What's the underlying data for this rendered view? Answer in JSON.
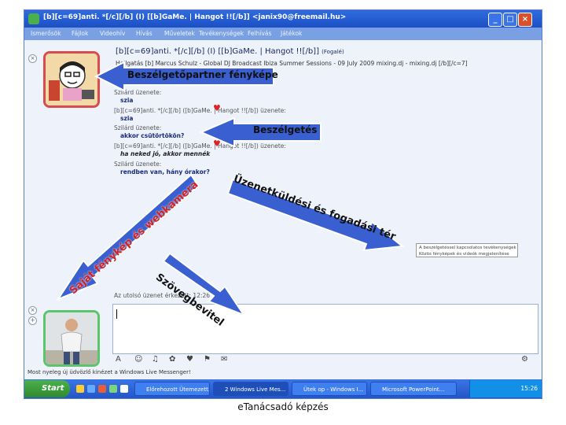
{
  "window": {
    "title": "[b][c=69]anti. *[/c][/b] (I) [[b]GaMe. | Hangot !![/b]] <janix90@freemail.hu>",
    "controls": {
      "minimize": "_",
      "maximize": "□",
      "close": "×"
    }
  },
  "menu": {
    "items": [
      "Ismerősök",
      "Fájlok",
      "Videohív",
      "Hívás",
      "Műveletek",
      "Tevékenységek",
      "Felhívás",
      "Játékok"
    ]
  },
  "conversation": {
    "contact_line": "[b][c=69]anti. *[/c][/b] (I) [[b]GaMe. | Hangot !![/b]]",
    "contact_email": "(Fogalé)",
    "status_line": "Hallgatás [b] Marcus Schulz - Global DJ Broadcast Ibiza Summer Sessions - 09 July 2009 mixing.dj - mixing.dj [/b][/c=7]"
  },
  "messages": [
    {
      "who": "Szilárd üzenete:",
      "text": "szia",
      "style": "normal"
    },
    {
      "who": "[b][c=69]anti. *[/c][/b]   ([b]GaMe. | Hangot !![/b]) üzenete:",
      "text": "szia",
      "style": "normal"
    },
    {
      "who": "Szilárd üzenete:",
      "text": "akkor csütörtökön?",
      "style": "normal"
    },
    {
      "who": "[b][c=69]anti. *[/c][/b]   ([b]GaMe. | Hangot !![/b]) üzenete:",
      "text": "ha neked jó, akkor mennék",
      "style": "ital"
    },
    {
      "who": "Szilárd üzenete:",
      "text": "rendben van, hány órakor?",
      "style": "normal"
    }
  ],
  "last_message": "Az utolsó üzenet érkezett: 12:26",
  "side_note": {
    "line1": "A beszélgetéssel kapcsolatos tevékenységek",
    "line2": "Közös fényképek és videók megjelenítése"
  },
  "input": {
    "toolbar": [
      "A",
      "☺",
      "♫",
      "✿",
      "♥",
      "⚑",
      "✉"
    ],
    "send_icon": "⚙"
  },
  "ad_strip": "Most nyeleg új üdvözlő kinézet a Windows Live Messenger!",
  "taskbar": {
    "start_label": "Start",
    "tasks": [
      "Előrehozott Ütemezett...",
      "2 Windows Live Mes...",
      "Ütek op - Windows I...",
      "Microsoft PowerPoint..."
    ],
    "clock": "15:26"
  },
  "callouts": {
    "partner_photo": "Beszélgetőpartner fényképe",
    "conversation": "Beszélgetés",
    "own_photo_webcam": "Saját fénykép és webkamera",
    "message_area": "Üzenetküldési és fogadási tér",
    "text_editor": "Szövegbevitel"
  },
  "colors": {
    "titlebar": "#1d4fc4",
    "partner_frame": "#d94c4c",
    "own_frame": "#5cc46a",
    "message_text": "#1a2a80",
    "arrow": "#3a5fd0",
    "arrow_edge": "#ffffff"
  },
  "footer": "eTanácsadó képzés"
}
